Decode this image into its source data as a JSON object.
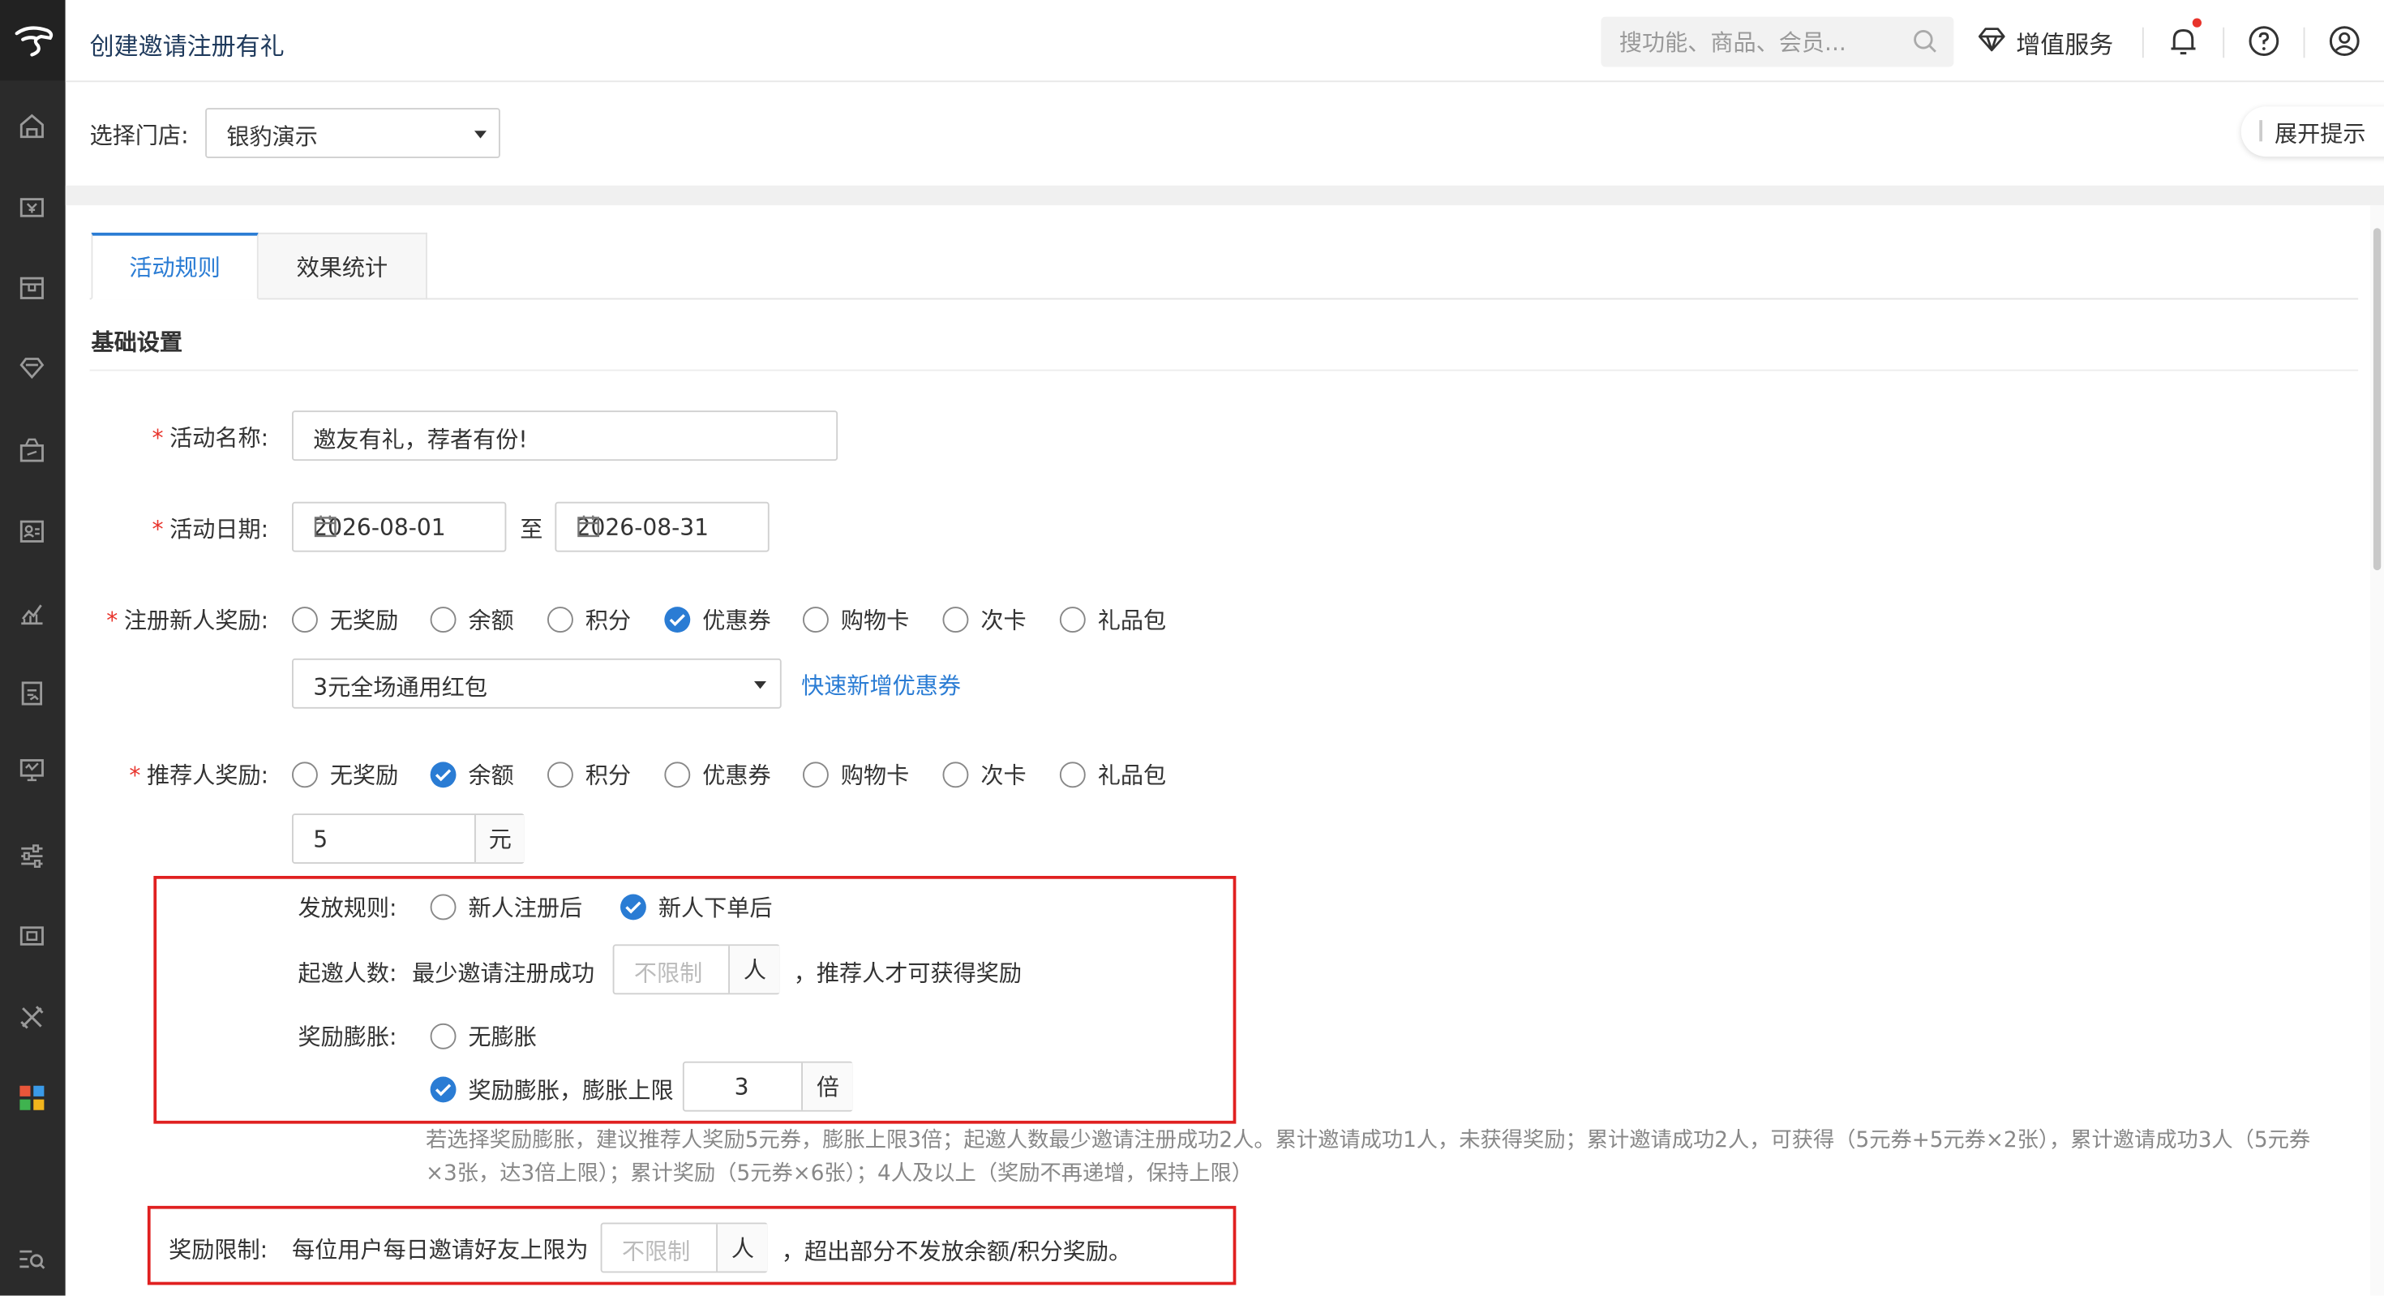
{
  "header": {
    "title": "创建邀请注册有礼",
    "search_placeholder": "搜功能、商品、会员...",
    "value_added_label": "增值服务"
  },
  "store": {
    "label": "选择门店:",
    "selected": "银豹演示"
  },
  "expand_tip_label": "展开提示",
  "tabs": [
    {
      "label": "活动规则",
      "active": true
    },
    {
      "label": "效果统计",
      "active": false
    }
  ],
  "section_title": "基础设置",
  "form": {
    "activity_name": {
      "label": "活动名称:",
      "value": "邀友有礼，荐者有份!"
    },
    "activity_date": {
      "label": "活动日期:",
      "start": "2026-08-01",
      "separator": "至",
      "end": "2026-08-31"
    },
    "new_user_reward": {
      "label": "注册新人奖励:",
      "options": [
        "无奖励",
        "余额",
        "积分",
        "优惠券",
        "购物卡",
        "次卡",
        "礼品包"
      ],
      "selected": "优惠券",
      "coupon_selected": "3元全场通用红包",
      "quick_add_link": "快速新增优惠券"
    },
    "referrer_reward": {
      "label": "推荐人奖励:",
      "options": [
        "无奖励",
        "余额",
        "积分",
        "优惠券",
        "购物卡",
        "次卡",
        "礼品包"
      ],
      "selected": "余额",
      "amount": "5",
      "unit": "元"
    },
    "issue_rule": {
      "label": "发放规则:",
      "options": [
        "新人注册后",
        "新人下单后"
      ],
      "selected": "新人下单后"
    },
    "min_invite": {
      "label": "起邀人数:",
      "prefix": "最少邀请注册成功",
      "placeholder": "不限制",
      "unit": "人",
      "suffix": "，推荐人才可获得奖励"
    },
    "reward_inflation": {
      "label": "奖励膨胀:",
      "option_none": "无膨胀",
      "option_inflate": "奖励膨胀，膨胀上限",
      "selected": "奖励膨胀，膨胀上限",
      "limit": "3",
      "unit": "倍"
    },
    "hint_text": "若选择奖励膨胀，建议推荐人奖励5元券，膨胀上限3倍；起邀人数最少邀请注册成功2人。累计邀请成功1人，未获得奖励；累计邀请成功2人，可获得（5元券+5元券×2张），累计邀请成功3人（5元券×3张，达3倍上限）；累计奖励（5元券×6张）；4人及以上（奖励不再递增，保持上限）",
    "reward_limit": {
      "label": "奖励限制:",
      "prefix": "每位用户每日邀请好友上限为",
      "placeholder": "不限制",
      "unit": "人",
      "suffix": "，超出部分不发放余额/积分奖励。"
    }
  },
  "colors": {
    "accent": "#2a7cd4",
    "sidebar": "#2b2b2b",
    "required": "#e8332b",
    "highlight_box": "#e02020"
  },
  "sidebar_icons": [
    "home-icon",
    "cashier-icon",
    "inventory-icon",
    "member-icon",
    "marketing-icon",
    "employee-icon",
    "report-icon",
    "finance-icon",
    "online-store-icon",
    "settings-icon",
    "device-icon",
    "tools-icon",
    "apps-icon",
    "search-menu-icon"
  ]
}
